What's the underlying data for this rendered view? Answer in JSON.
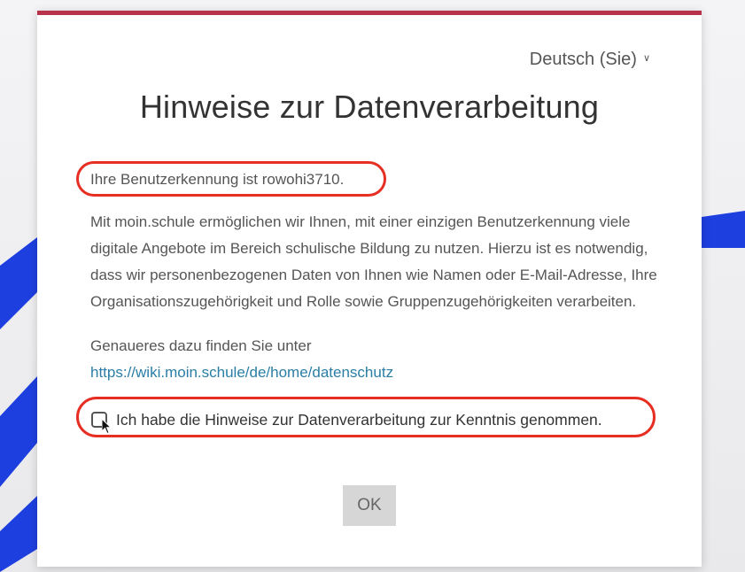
{
  "dialog": {
    "language": "Deutsch (Sie)",
    "title": "Hinweise zur Datenverarbeitung",
    "user_id_text": "Ihre Benutzerkennung ist rowohi3710.",
    "description": "Mit moin.schule ermöglichen wir Ihnen, mit einer einzigen Benutzerkennung viele digitale Angebote im Bereich schulische Bildung zu nutzen. Hierzu ist es notwendig, dass wir personenbezogenen Daten von Ihnen wie Namen oder E-Mail-Adresse, Ihre Organisationszugehörigkeit und Rolle sowie Gruppenzugehörigkeiten verarbeiten.",
    "more_info_text": "Genaueres dazu finden Sie unter",
    "more_info_link": "https://wiki.moin.schule/de/home/datenschutz",
    "checkbox_label": "Ich habe die Hinweise zur Datenverarbeitung zur Kenntnis genommen.",
    "checkbox_checked": false,
    "ok_label": "OK"
  },
  "icons": {
    "language_chevron": "chevron-down-icon",
    "cursor": "mouse-pointer-icon"
  },
  "colors": {
    "accent_bar": "#b9324c",
    "link": "#2a7ea6",
    "annotation": "#e62e22",
    "background_stripe": "#1e3fe0",
    "ok_button": "#d6d6d6"
  }
}
